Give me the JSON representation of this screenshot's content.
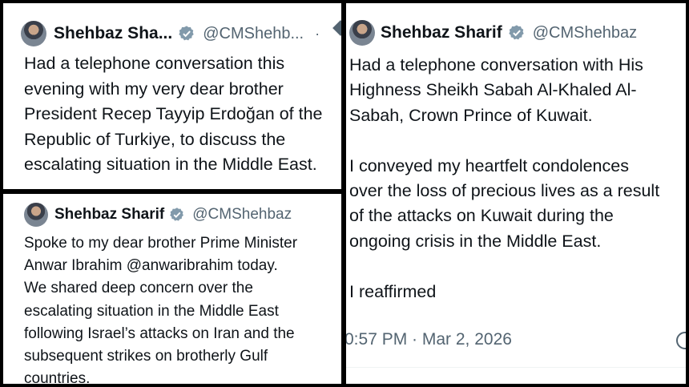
{
  "colors": {
    "verified": "#829aab",
    "text": "#0f1419",
    "muted": "#536471"
  },
  "tweets": [
    {
      "name": "Shehbaz Sha...",
      "handle": "@CMShehb...",
      "more": "·",
      "avatar_icon": "profile-avatar",
      "verified_icon": "verified-badge-icon",
      "text": "Had a telephone conversation this\nevening with my very dear brother\nPresident Recep Tayyip Erdoğan of the\nRepublic of Turkiye, to discuss the\nescalating situation in the Middle East."
    },
    {
      "name": "Shehbaz Sharif",
      "handle": "@CMShehbaz",
      "avatar_icon": "profile-avatar",
      "verified_icon": "verified-badge-icon",
      "text": "Spoke to my dear brother Prime Minister\nAnwar Ibrahim @anwaribrahim today.\nWe shared deep concern over the\nescalating situation in the Middle East\nfollowing Israel’s attacks on Iran and the\nsubsequent strikes on brotherly Gulf\ncountries."
    },
    {
      "name": "Shehbaz Sharif",
      "handle": "@CMShehbaz",
      "avatar_icon": "profile-avatar",
      "verified_icon": "verified-badge-icon",
      "text": "Had a telephone conversation with His\nHighness Sheikh Sabah Al-Khaled Al-\nSabah, Crown Prince of Kuwait.\n\nI conveyed my heartfelt condolences\nover the loss of precious lives as a result\nof the attacks on Kuwait during the\nongoing crisis in the Middle East.\n\nI reaffirmed",
      "timestamp": "0:57 PM · Mar 2, 2026"
    }
  ]
}
